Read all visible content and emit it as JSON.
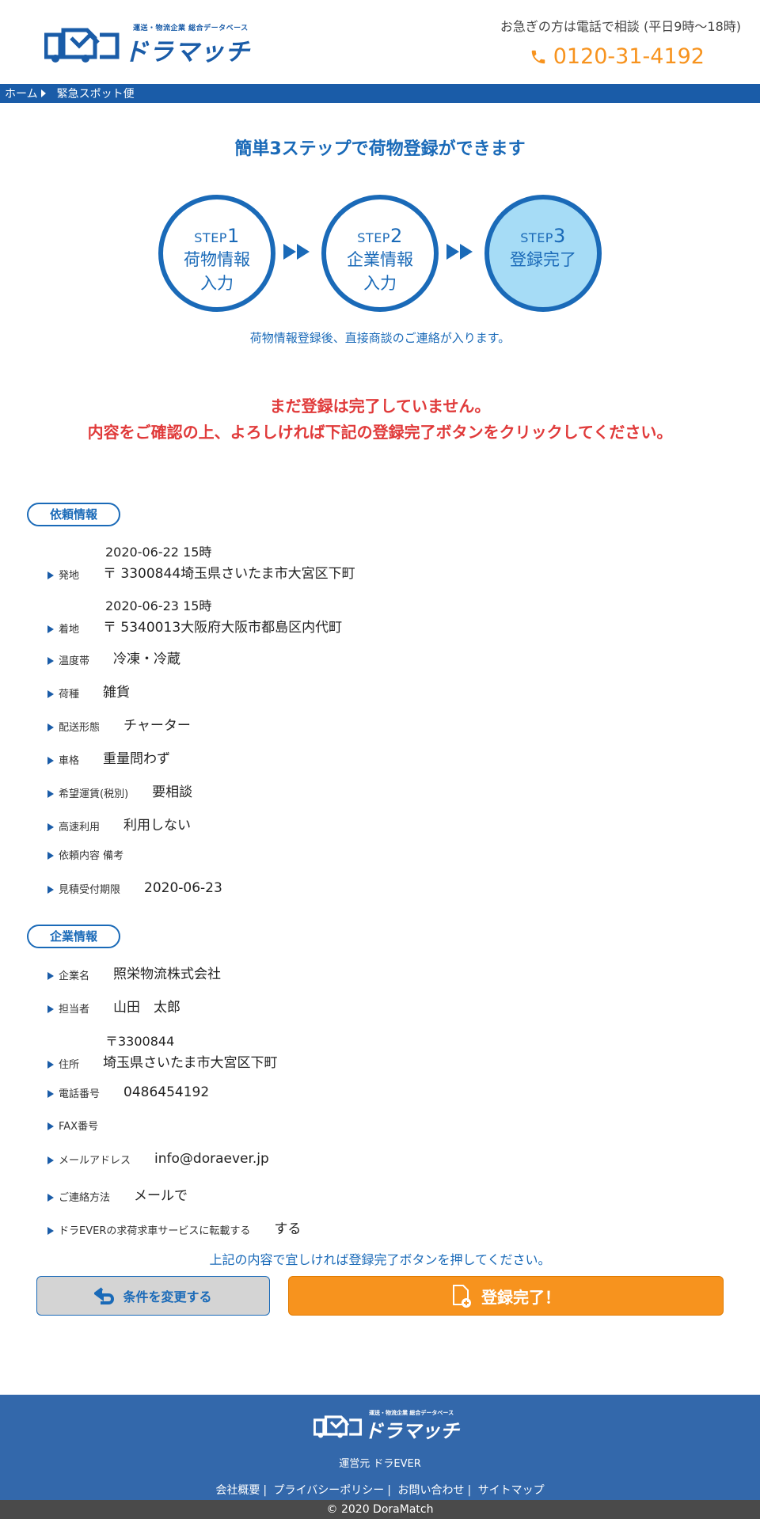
{
  "header": {
    "logo_tagline": "運送・物流企業 総合データベース",
    "logo_text": "ドラマッチ",
    "note": "お急ぎの方は電話で相談 (平日9時〜18時)",
    "phone": "0120-31-4192"
  },
  "breadcrumb": {
    "home": "ホーム",
    "current": "緊急スポット便"
  },
  "steps": {
    "title": "簡単3ステップで荷物登録ができます",
    "items": [
      {
        "label": "STEP",
        "num": "1",
        "name1": "荷物情報",
        "name2": "入力"
      },
      {
        "label": "STEP",
        "num": "2",
        "name1": "企業情報",
        "name2": "入力"
      },
      {
        "label": "STEP",
        "num": "3",
        "name1": "登録完了",
        "name2": ""
      }
    ],
    "active_step": 3,
    "note": "荷物情報登録後、直接商談のご連絡が入ります。"
  },
  "warning": {
    "line1": "まだ登録は完了していません。",
    "line2": "内容をご確認の上、よろしければ下記の登録完了ボタンをクリックしてください。"
  },
  "request": {
    "heading": "依頼情報",
    "origin_date": "2020-06-22 15時",
    "origin_label": "発地",
    "origin_value": "〒 3300844埼玉県さいたま市大宮区下町",
    "dest_date": "2020-06-23 15時",
    "dest_label": "着地",
    "dest_value": "〒 5340013大阪府大阪市都島区内代町",
    "rows": [
      {
        "label": "温度帯",
        "value": "冷凍・冷蔵"
      },
      {
        "label": "荷種",
        "value": "雑貨"
      },
      {
        "label": "配送形態",
        "value": "チャーター"
      },
      {
        "label": "車格",
        "value": "重量問わず"
      },
      {
        "label": "希望運賃(税別)",
        "value": "要相談"
      },
      {
        "label": "高速利用",
        "value": "利用しない"
      },
      {
        "label": "依頼内容 備考",
        "value": ""
      },
      {
        "label": "見積受付期限",
        "value": "2020-06-23"
      }
    ]
  },
  "company": {
    "heading": "企業情報",
    "rows_top": [
      {
        "label": "企業名",
        "value": "照栄物流株式会社"
      },
      {
        "label": "担当者",
        "value": "山田　太郎"
      }
    ],
    "address_zip": "〒3300844",
    "address_label": "住所",
    "address_value": "埼玉県さいたま市大宮区下町",
    "rows_bottom": [
      {
        "label": "電話番号",
        "value": "0486454192"
      },
      {
        "label": "FAX番号",
        "value": ""
      },
      {
        "label": "メールアドレス",
        "value": "info@doraever.jp"
      },
      {
        "label": "ご連絡方法",
        "value": "メールで"
      },
      {
        "label": "ドラEVERの求荷求車サービスに転載する",
        "value": "する"
      }
    ]
  },
  "confirm_note": "上記の内容で宜しければ登録完了ボタンを押してください。",
  "buttons": {
    "back": "条件を変更する",
    "submit": "登録完了！"
  },
  "footer": {
    "logo_tagline": "運送・物流企業 総合データベース",
    "logo_text": "ドラマッチ",
    "operator": "運営元 ドラEVER",
    "links": [
      "会社概要",
      "プライバシーポリシー",
      "お問い合わせ",
      "サイトマップ"
    ],
    "copyright": "© 2020 DoraMatch"
  },
  "colors": {
    "brand": "#1a5ca8",
    "accent": "#f7931e",
    "warning": "#e03a3a",
    "footer": "#3368ab"
  }
}
